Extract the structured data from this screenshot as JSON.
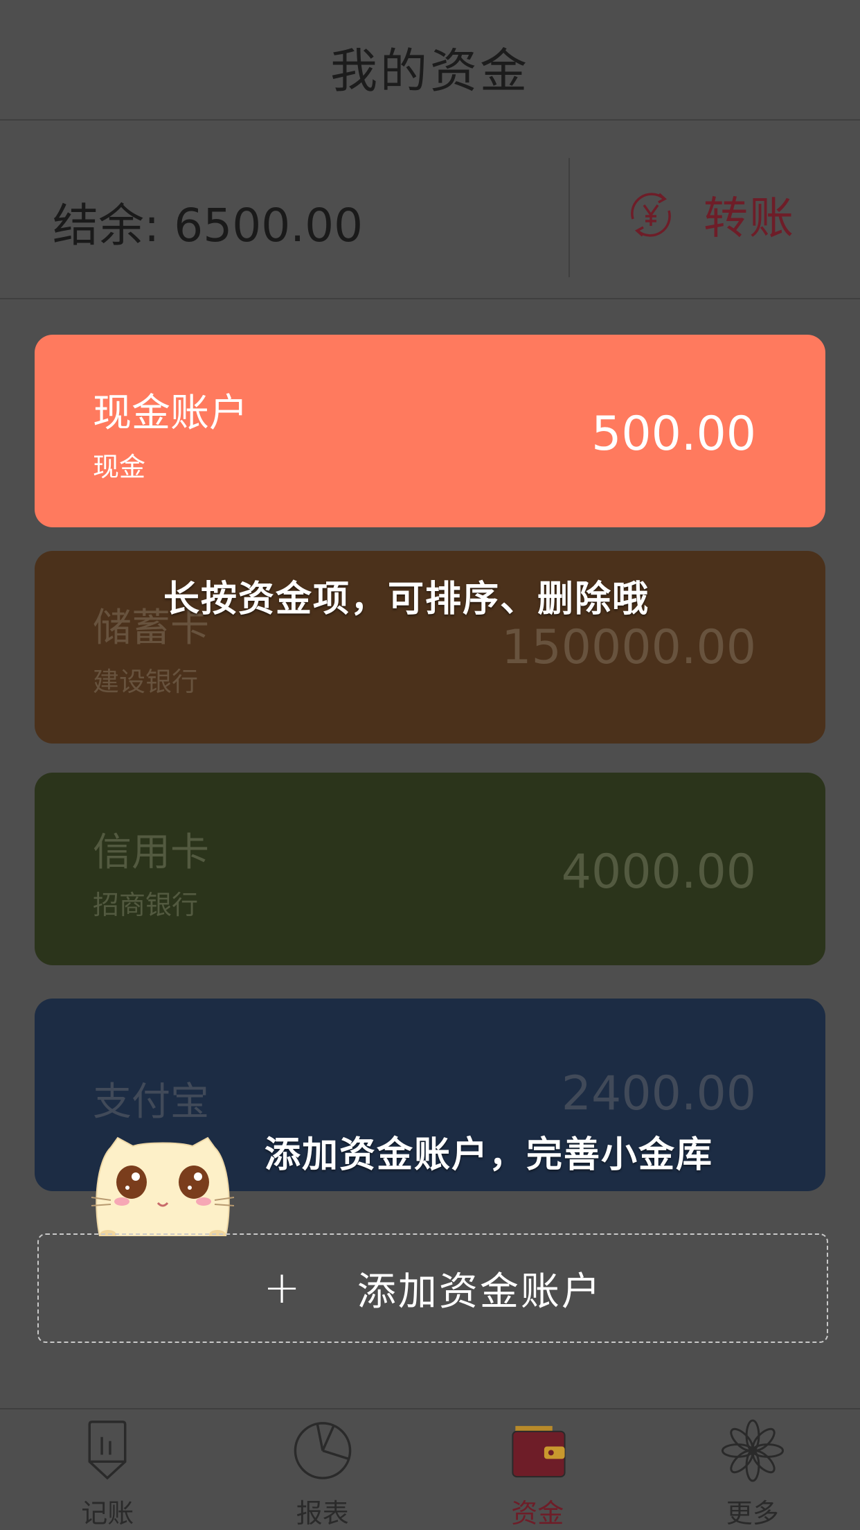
{
  "header": {
    "title": "我的资金"
  },
  "summary": {
    "balance_text": "结余: 6500.00",
    "transfer_label": "转账"
  },
  "accounts": [
    {
      "name": "现金账户",
      "bank": "现金",
      "amount": "500.00",
      "color": "#ff7a5e"
    },
    {
      "name": "储蓄卡",
      "bank": "建设银行",
      "amount": "150000.00",
      "color": "#4b311b"
    },
    {
      "name": "信用卡",
      "bank": "招商银行",
      "amount": "4000.00",
      "color": "#2b341b"
    },
    {
      "name": "支付宝",
      "amount": "2400.00",
      "color": "#1c2c44"
    }
  ],
  "tips": {
    "sort_tip": "长按资金项，可排序、删除哦",
    "add_tip": "添加资金账户，完善小金库"
  },
  "add_button": {
    "icon": "+",
    "label": "添加资金账户"
  },
  "tabbar": {
    "items": [
      {
        "label": "记账",
        "icon": "pencil-icon"
      },
      {
        "label": "报表",
        "icon": "pie-chart-icon"
      },
      {
        "label": "资金",
        "icon": "wallet-icon",
        "active": true
      },
      {
        "label": "更多",
        "icon": "flower-icon"
      }
    ]
  },
  "colors": {
    "accent": "#6e1d28",
    "background": "#4e4e4e"
  }
}
